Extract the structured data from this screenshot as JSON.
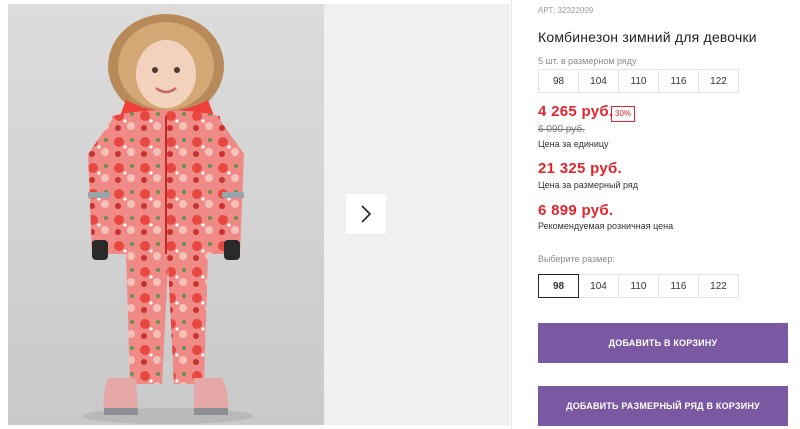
{
  "product": {
    "article": "АРТ: 32322009",
    "title": "Комбинезон зимний для девочки",
    "series_caption": "5 шт. в размерном ряду",
    "series_sizes": [
      "98",
      "104",
      "110",
      "116",
      "122"
    ],
    "price": "4 265 руб.",
    "discount": "30%",
    "old_price": "6 090 руб.",
    "price_unit_caption": "Цена за единицу",
    "series_price": "21 325 руб.",
    "series_price_caption": "Цена за размерный ряд",
    "rrp_price": "6 899 руб.",
    "rrp_caption": "Рекомендуемая розничная цена",
    "choose_size_label": "Выберите размер:",
    "sizes": [
      "98",
      "104",
      "110",
      "116",
      "122"
    ],
    "selected_size": "98"
  },
  "buttons": {
    "add_to_cart": "ДОБАВИТЬ В КОРЗИНУ",
    "add_series_to_cart": "ДОБАВИТЬ РАЗМЕРНЫЙ РЯД В КОРЗИНУ"
  },
  "gallery": {
    "next_icon": "chevron-right-icon"
  },
  "colors": {
    "accent_button": "#7b59a2",
    "price_red": "#e3242b"
  }
}
